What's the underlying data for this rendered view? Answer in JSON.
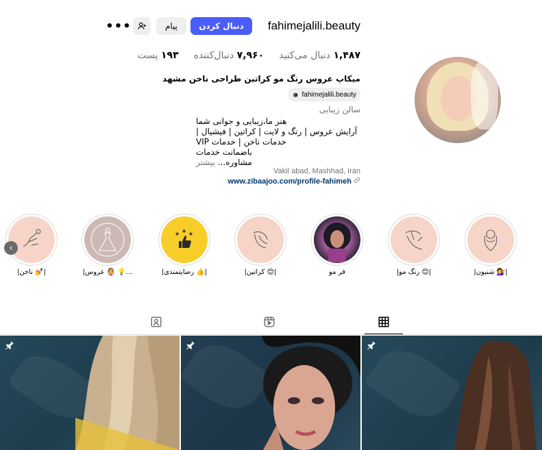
{
  "header": {
    "username": "fahimejalili.beauty",
    "follow_label": "دنبال کردن",
    "message_label": "پیام",
    "suggest_icon": "add-person-icon",
    "more_icon": "more-dots-icon",
    "more_glyph": "•••"
  },
  "stats": {
    "posts_value": "۱۹۳",
    "posts_label": "پست",
    "followers_value": "۷,۹۶۰",
    "followers_label": "دنبال‌کننده",
    "following_value": "۱,۴۸۷",
    "following_label": "دنبال می‌کنید"
  },
  "bio": {
    "name": "میکاپ عروس رنگ مو کراتین طراحی ناخن مشهد",
    "threads_handle": "fahimejalili.beauty",
    "threads_icon": "threads-icon",
    "category": "سالن زیبایی",
    "lines": [
      "هنر ما،زیبایی و جوانی شما",
      "آرایش عروس | رنگ و لایت | کراتین | فیشیال |",
      "خدمات ناخن | خدمات VIP",
      "باضمانت خدمات",
      "مشاوره..."
    ],
    "more_label": "بیشتر",
    "address": "Vakil abad, Mashhad, Iran",
    "website": "www.zibaajoo.com/profile-fahimeh",
    "link_icon": "link-icon"
  },
  "highlights": [
    {
      "label": "|شنیون 💇‍♀️|",
      "style": "pink"
    },
    {
      "label": "|رنگ مو 😊|",
      "style": "pink"
    },
    {
      "label": "فر مو",
      "style": "photo"
    },
    {
      "label": "|کراتین 😊|",
      "style": "pink"
    },
    {
      "label": "|رضایتمندی 👍|",
      "style": "gold"
    },
    {
      "label": "|عروس 👰 💡...",
      "style": "gray"
    },
    {
      "label": "|ناخن 💅|",
      "style": "pink"
    }
  ],
  "scroll_left_glyph": "‹",
  "tabs": [
    {
      "name": "posts",
      "icon": "grid-icon",
      "active": true
    },
    {
      "name": "reels",
      "icon": "reels-icon",
      "active": false
    },
    {
      "name": "tagged",
      "icon": "tagged-icon",
      "active": false
    }
  ],
  "posts": [
    {
      "pinned": true,
      "icon": "pin-icon"
    },
    {
      "pinned": true,
      "icon": "pin-icon"
    },
    {
      "pinned": true,
      "icon": "pin-icon"
    }
  ],
  "colors": {
    "accent": "#4a5df9",
    "link": "#00376b",
    "muted": "#737373",
    "button_bg": "#efefef"
  }
}
